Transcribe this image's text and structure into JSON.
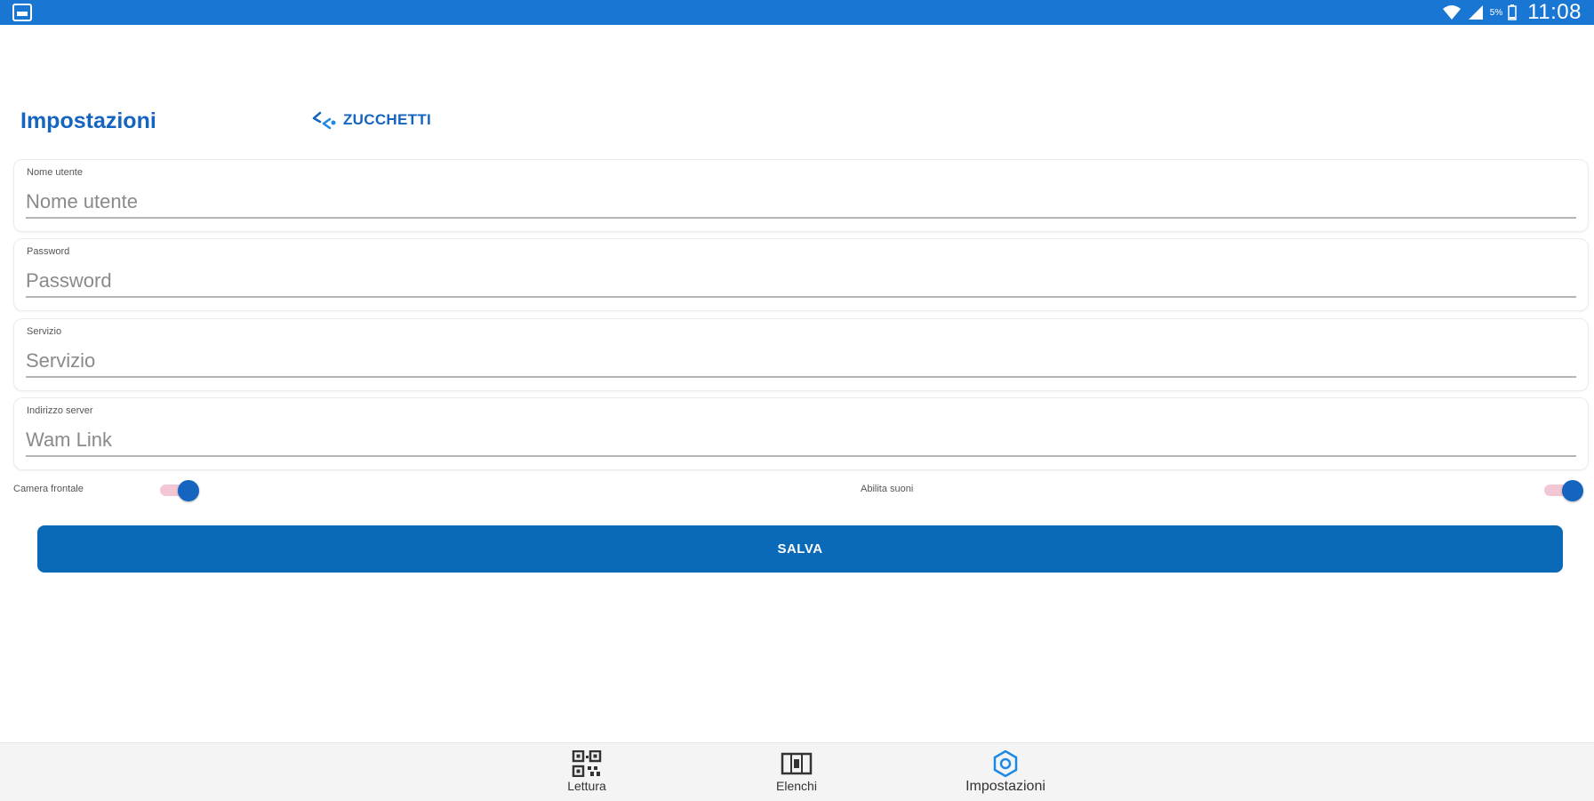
{
  "status_bar": {
    "time": "11:08",
    "battery_percent": "5%"
  },
  "header": {
    "title": "Impostazioni",
    "logo_text": "ZUCCHETTI"
  },
  "form": {
    "fields": [
      {
        "label": "Nome utente",
        "placeholder": "Nome utente",
        "value": ""
      },
      {
        "label": "Password",
        "placeholder": "Password",
        "value": ""
      },
      {
        "label": "Servizio",
        "placeholder": "Servizio",
        "value": ""
      },
      {
        "label": "Indirizzo server",
        "placeholder": "Wam Link",
        "value": ""
      }
    ],
    "toggles": [
      {
        "label": "Camera frontale",
        "on": true
      },
      {
        "label": "Abilita suoni",
        "on": true
      }
    ],
    "save_label": "SALVA"
  },
  "bottom_nav": {
    "items": [
      {
        "label": "Lettura",
        "icon": "qr-code-icon",
        "active": false
      },
      {
        "label": "Elenchi",
        "icon": "list-card-icon",
        "active": false
      },
      {
        "label": "Impostazioni",
        "icon": "settings-gear-icon",
        "active": true
      }
    ]
  },
  "colors": {
    "primary": "#1565c0",
    "status_bar": "#1976d2",
    "button": "#0a6ab8",
    "toggle_track": "#f3c6d6"
  }
}
